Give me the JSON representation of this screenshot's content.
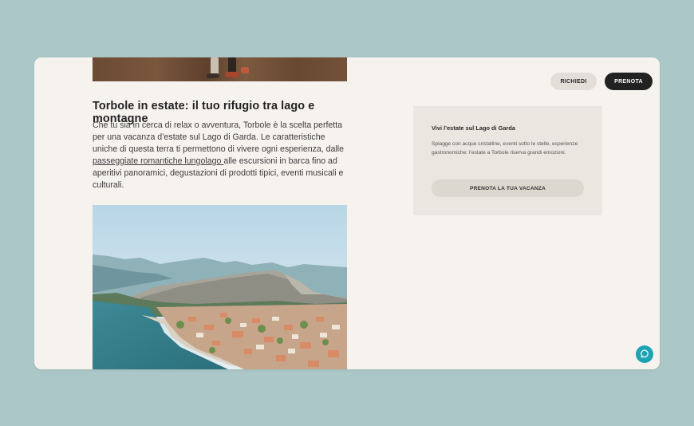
{
  "header": {
    "request_label": "RICHIEDI",
    "book_label": "PRENOTA"
  },
  "article": {
    "title": "Torbole in estate: il tuo rifugio tra lago e montagne",
    "body_before_link": "Che tu sia in cerca di relax o avventura, Torbole è la scelta perfetta per una vacanza d’estate sul Lago di Garda. Le caratteristiche uniche di questa terra ti permettono di vivere ogni esperienza, dalle ",
    "body_link": "passeggiate romantiche lungolago ",
    "body_after_link": "alle escursioni in barca fino ad aperitivi panoramici, degustazioni di prodotti tipici, eventi musicali e culturali."
  },
  "promo": {
    "title": "Vivi l’estate sul Lago di Garda",
    "text": "Spiagge con acque cristalline, eventi sotto le stelle, esperienze gastronomiche: l’estate a Torbole riserva grandi emozioni.",
    "button_label": "PRENOTA LA TUA VACANZA"
  },
  "chat": {
    "icon": "chat-bubble-icon"
  },
  "colors": {
    "background": "#abc7c7",
    "window": "#f6f3ef",
    "card": "#eae6e0",
    "primary_button": "#222222",
    "chat_accent": "#1ea3b4"
  }
}
